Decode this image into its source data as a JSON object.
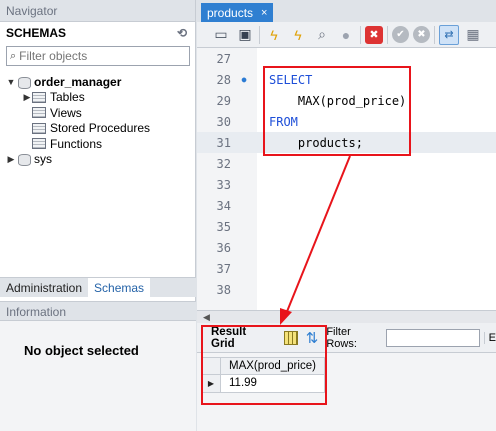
{
  "navigator": {
    "title": "Navigator",
    "schemas_label": "SCHEMAS",
    "filter_placeholder": "Filter objects",
    "tree": {
      "db1": "order_manager",
      "children": [
        "Tables",
        "Views",
        "Stored Procedures",
        "Functions"
      ],
      "db2": "sys"
    },
    "tabs": [
      "Administration",
      "Schemas"
    ],
    "active_tab": "Schemas",
    "info_title": "Information",
    "no_object": "No object selected"
  },
  "editor": {
    "tab_title": "products",
    "tab_close": "×",
    "lines": [
      {
        "num": "27",
        "text": ""
      },
      {
        "num": "28",
        "kw": "SELECT",
        "marker": true
      },
      {
        "num": "29",
        "text": "    MAX(prod_price)"
      },
      {
        "num": "30",
        "kw": "FROM"
      },
      {
        "num": "31",
        "text": "    products;"
      },
      {
        "num": "32",
        "text": ""
      },
      {
        "num": "33",
        "text": ""
      },
      {
        "num": "34",
        "text": ""
      },
      {
        "num": "35",
        "text": ""
      },
      {
        "num": "36",
        "text": ""
      },
      {
        "num": "37",
        "text": ""
      },
      {
        "num": "38",
        "text": ""
      }
    ]
  },
  "result": {
    "tab_label": "Result Grid",
    "filter_label": "Filter Rows:",
    "edit_label": "E",
    "column": "MAX(prod_price)",
    "rows": [
      "11.99"
    ]
  },
  "colors": {
    "highlight": "#e8141b",
    "tab_active": "#2f7fd1",
    "keyword": "#1d4ed8"
  }
}
